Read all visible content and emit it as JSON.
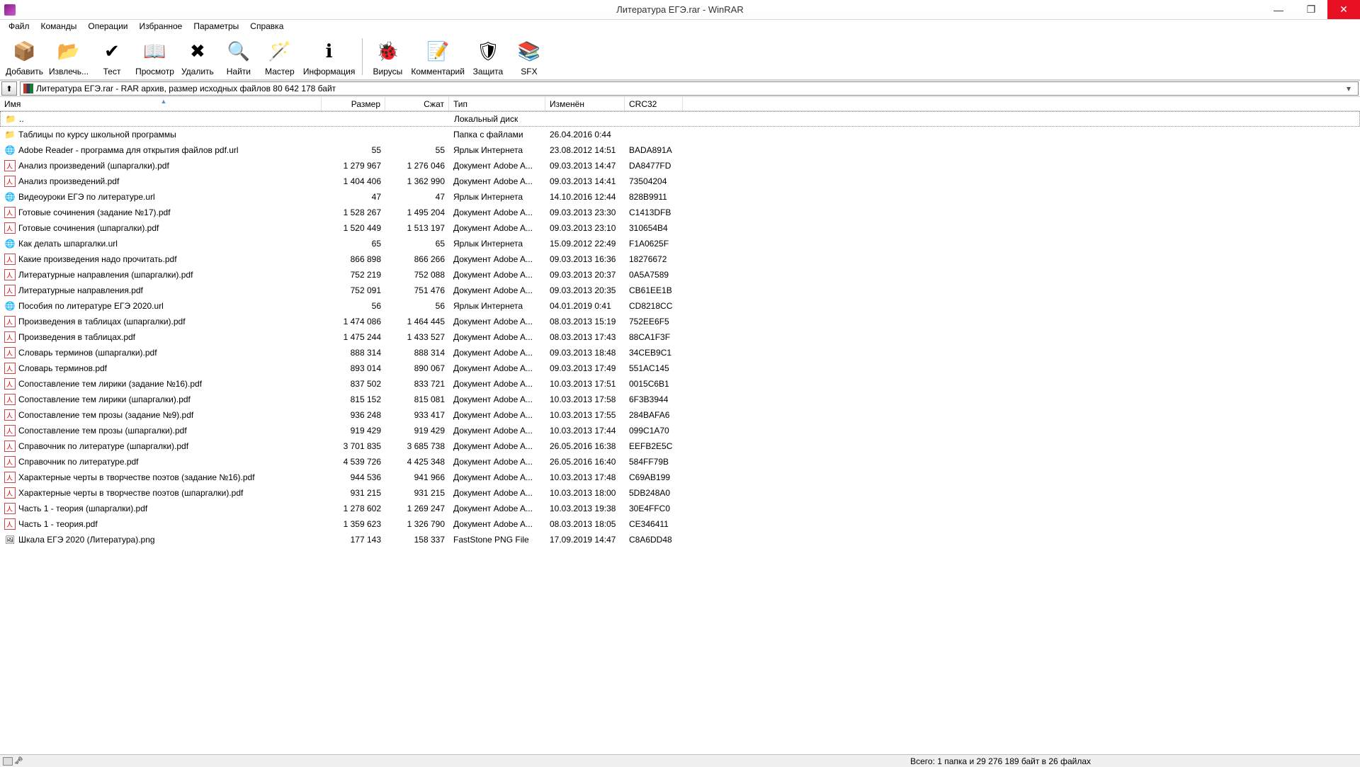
{
  "title": "Литература ЕГЭ.rar - WinRAR",
  "menu": [
    "Файл",
    "Команды",
    "Операции",
    "Избранное",
    "Параметры",
    "Справка"
  ],
  "toolbar": [
    {
      "id": "add",
      "label": "Добавить",
      "glyph": "📦"
    },
    {
      "id": "extract",
      "label": "Извлечь...",
      "glyph": "📂"
    },
    {
      "id": "test",
      "label": "Тест",
      "glyph": "✔"
    },
    {
      "id": "view",
      "label": "Просмотр",
      "glyph": "📖"
    },
    {
      "id": "delete",
      "label": "Удалить",
      "glyph": "✖"
    },
    {
      "id": "find",
      "label": "Найти",
      "glyph": "🔍"
    },
    {
      "id": "wizard",
      "label": "Мастер",
      "glyph": "🪄"
    },
    {
      "id": "info",
      "label": "Информация",
      "glyph": "ℹ"
    },
    {
      "id": "virus",
      "label": "Вирусы",
      "glyph": "🐞"
    },
    {
      "id": "comment",
      "label": "Комментарий",
      "glyph": "📝"
    },
    {
      "id": "protect",
      "label": "Защита",
      "glyph": "🛡"
    },
    {
      "id": "sfx",
      "label": "SFX",
      "glyph": "📚"
    }
  ],
  "toolbar_split_after": 7,
  "address": "Литература ЕГЭ.rar - RAR архив, размер исходных файлов 80 642 178 байт",
  "columns": {
    "name": "Имя",
    "size": "Размер",
    "packed": "Сжат",
    "type": "Тип",
    "modified": "Изменён",
    "crc": "CRC32"
  },
  "parent_row": {
    "name": "..",
    "type": "Локальный диск"
  },
  "rows": [
    {
      "ico": "folder",
      "name": "Таблицы по курсу школьной программы",
      "size": "",
      "packed": "",
      "type": "Папка с файлами",
      "mod": "26.04.2016 0:44",
      "crc": ""
    },
    {
      "ico": "url",
      "name": "Adobe Reader - программа для открытия файлов pdf.url",
      "size": "55",
      "packed": "55",
      "type": "Ярлык Интернета",
      "mod": "23.08.2012 14:51",
      "crc": "BADA891A"
    },
    {
      "ico": "pdf",
      "name": "Анализ произведений (шпаргалки).pdf",
      "size": "1 279 967",
      "packed": "1 276 046",
      "type": "Документ Adobe A...",
      "mod": "09.03.2013 14:47",
      "crc": "DA8477FD"
    },
    {
      "ico": "pdf",
      "name": "Анализ произведений.pdf",
      "size": "1 404 406",
      "packed": "1 362 990",
      "type": "Документ Adobe A...",
      "mod": "09.03.2013 14:41",
      "crc": "73504204"
    },
    {
      "ico": "url",
      "name": "Видеоуроки ЕГЭ по литературе.url",
      "size": "47",
      "packed": "47",
      "type": "Ярлык Интернета",
      "mod": "14.10.2016 12:44",
      "crc": "828B9911"
    },
    {
      "ico": "pdf",
      "name": "Готовые сочинения (задание №17).pdf",
      "size": "1 528 267",
      "packed": "1 495 204",
      "type": "Документ Adobe A...",
      "mod": "09.03.2013 23:30",
      "crc": "C1413DFB"
    },
    {
      "ico": "pdf",
      "name": "Готовые сочинения (шпаргалки).pdf",
      "size": "1 520 449",
      "packed": "1 513 197",
      "type": "Документ Adobe A...",
      "mod": "09.03.2013 23:10",
      "crc": "310654B4"
    },
    {
      "ico": "url",
      "name": "Как делать шпаргалки.url",
      "size": "65",
      "packed": "65",
      "type": "Ярлык Интернета",
      "mod": "15.09.2012 22:49",
      "crc": "F1A0625F"
    },
    {
      "ico": "pdf",
      "name": "Какие произведения надо прочитать.pdf",
      "size": "866 898",
      "packed": "866 266",
      "type": "Документ Adobe A...",
      "mod": "09.03.2013 16:36",
      "crc": "18276672"
    },
    {
      "ico": "pdf",
      "name": "Литературные направления (шпаргалки).pdf",
      "size": "752 219",
      "packed": "752 088",
      "type": "Документ Adobe A...",
      "mod": "09.03.2013 20:37",
      "crc": "0A5A7589"
    },
    {
      "ico": "pdf",
      "name": "Литературные направления.pdf",
      "size": "752 091",
      "packed": "751 476",
      "type": "Документ Adobe A...",
      "mod": "09.03.2013 20:35",
      "crc": "CB61EE1B"
    },
    {
      "ico": "url",
      "name": "Пособия по литературе ЕГЭ 2020.url",
      "size": "56",
      "packed": "56",
      "type": "Ярлык Интернета",
      "mod": "04.01.2019 0:41",
      "crc": "CD8218CC"
    },
    {
      "ico": "pdf",
      "name": "Произведения в таблицах (шпаргалки).pdf",
      "size": "1 474 086",
      "packed": "1 464 445",
      "type": "Документ Adobe A...",
      "mod": "08.03.2013 15:19",
      "crc": "752EE6F5"
    },
    {
      "ico": "pdf",
      "name": "Произведения в таблицах.pdf",
      "size": "1 475 244",
      "packed": "1 433 527",
      "type": "Документ Adobe A...",
      "mod": "08.03.2013 17:43",
      "crc": "88CA1F3F"
    },
    {
      "ico": "pdf",
      "name": "Словарь терминов (шпаргалки).pdf",
      "size": "888 314",
      "packed": "888 314",
      "type": "Документ Adobe A...",
      "mod": "09.03.2013 18:48",
      "crc": "34CEB9C1"
    },
    {
      "ico": "pdf",
      "name": "Словарь терминов.pdf",
      "size": "893 014",
      "packed": "890 067",
      "type": "Документ Adobe A...",
      "mod": "09.03.2013 17:49",
      "crc": "551AC145"
    },
    {
      "ico": "pdf",
      "name": "Сопоставление тем лирики (задание №16).pdf",
      "size": "837 502",
      "packed": "833 721",
      "type": "Документ Adobe A...",
      "mod": "10.03.2013 17:51",
      "crc": "0015C6B1"
    },
    {
      "ico": "pdf",
      "name": "Сопоставление тем лирики (шпаргалки).pdf",
      "size": "815 152",
      "packed": "815 081",
      "type": "Документ Adobe A...",
      "mod": "10.03.2013 17:58",
      "crc": "6F3B3944"
    },
    {
      "ico": "pdf",
      "name": "Сопоставление тем прозы (задание №9).pdf",
      "size": "936 248",
      "packed": "933 417",
      "type": "Документ Adobe A...",
      "mod": "10.03.2013 17:55",
      "crc": "284BAFA6"
    },
    {
      "ico": "pdf",
      "name": "Сопоставление тем прозы (шпаргалки).pdf",
      "size": "919 429",
      "packed": "919 429",
      "type": "Документ Adobe A...",
      "mod": "10.03.2013 17:44",
      "crc": "099C1A70"
    },
    {
      "ico": "pdf",
      "name": "Справочник по литературе (шпаргалки).pdf",
      "size": "3 701 835",
      "packed": "3 685 738",
      "type": "Документ Adobe A...",
      "mod": "26.05.2016 16:38",
      "crc": "EEFB2E5C"
    },
    {
      "ico": "pdf",
      "name": "Справочник по литературе.pdf",
      "size": "4 539 726",
      "packed": "4 425 348",
      "type": "Документ Adobe A...",
      "mod": "26.05.2016 16:40",
      "crc": "584FF79B"
    },
    {
      "ico": "pdf",
      "name": "Характерные черты в творчестве поэтов (задание №16).pdf",
      "size": "944 536",
      "packed": "941 966",
      "type": "Документ Adobe A...",
      "mod": "10.03.2013 17:48",
      "crc": "C69AB199"
    },
    {
      "ico": "pdf",
      "name": "Характерные черты в творчестве поэтов (шпаргалки).pdf",
      "size": "931 215",
      "packed": "931 215",
      "type": "Документ Adobe A...",
      "mod": "10.03.2013 18:00",
      "crc": "5DB248A0"
    },
    {
      "ico": "pdf",
      "name": "Часть 1 - теория (шпаргалки).pdf",
      "size": "1 278 602",
      "packed": "1 269 247",
      "type": "Документ Adobe A...",
      "mod": "10.03.2013 19:38",
      "crc": "30E4FFC0"
    },
    {
      "ico": "pdf",
      "name": "Часть 1 - теория.pdf",
      "size": "1 359 623",
      "packed": "1 326 790",
      "type": "Документ Adobe A...",
      "mod": "08.03.2013 18:05",
      "crc": "CE346411"
    },
    {
      "ico": "png",
      "name": "Шкала ЕГЭ 2020 (Литература).png",
      "size": "177 143",
      "packed": "158 337",
      "type": "FastStone PNG File",
      "mod": "17.09.2019 14:47",
      "crc": "C8A6DD48"
    }
  ],
  "statusbar": "Всего: 1 папка и 29 276 189 байт в 26 файлах"
}
